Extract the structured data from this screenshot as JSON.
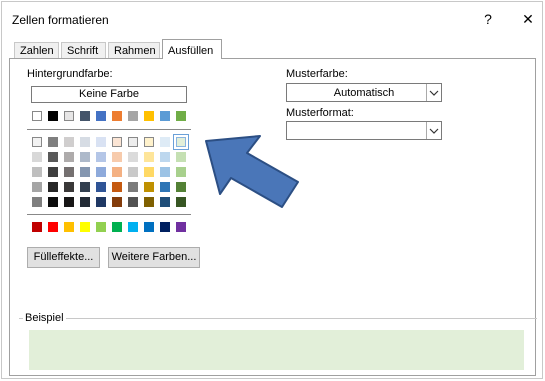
{
  "dialog": {
    "title": "Zellen formatieren",
    "help": "?",
    "close": "✕"
  },
  "tabs": [
    {
      "label": "Zahlen"
    },
    {
      "label": "Schrift"
    },
    {
      "label": "Rahmen"
    },
    {
      "label": "Ausfüllen",
      "active": true
    }
  ],
  "background": {
    "label": "Hintergrundfarbe:",
    "no_color_label": "Keine Farbe",
    "theme_top_row": [
      "#ffffff",
      "#000000",
      "#e7e6e6",
      "#44546a",
      "#4472c4",
      "#ed7d31",
      "#a5a5a5",
      "#ffc000",
      "#5b9bd5",
      "#70ad47"
    ],
    "theme_shades": [
      [
        "#f2f2f2",
        "#7f7f7f",
        "#d0cece",
        "#d6dce4",
        "#d9e2f3",
        "#fbe5d5",
        "#ededed",
        "#fff2cc",
        "#deebf6",
        "#e2efd9"
      ],
      [
        "#d8d8d8",
        "#595959",
        "#aeabab",
        "#adb9ca",
        "#b4c6e7",
        "#f7cbac",
        "#dbdbdb",
        "#fee599",
        "#bdd7ee",
        "#c5e0b3"
      ],
      [
        "#bfbfbf",
        "#3f3f3f",
        "#757070",
        "#8496b0",
        "#8eaadb",
        "#f4b183",
        "#c9c9c9",
        "#ffd965",
        "#9cc3e5",
        "#a8d08d"
      ],
      [
        "#a5a5a5",
        "#262626",
        "#3a3838",
        "#323f4f",
        "#2f5496",
        "#c55a11",
        "#7b7b7b",
        "#bf9000",
        "#2e75b5",
        "#538135"
      ],
      [
        "#7f7f7f",
        "#0c0c0c",
        "#171616",
        "#222a35",
        "#1f3864",
        "#833c0b",
        "#525252",
        "#7f6000",
        "#1f4e79",
        "#375623"
      ]
    ],
    "selected_color": "#e2efd9",
    "standard_colors": [
      "#c00000",
      "#ff0000",
      "#ffc000",
      "#ffff00",
      "#92d050",
      "#00b050",
      "#00b0f0",
      "#0070c0",
      "#002060",
      "#7030a0"
    ]
  },
  "buttons": {
    "fill_effects": "Fülleffekte...",
    "more_colors": "Weitere Farben..."
  },
  "pattern": {
    "color_label": "Musterfarbe:",
    "color_value": "Automatisch",
    "style_label": "Musterformat:",
    "style_value": ""
  },
  "sample": {
    "label": "Beispiel",
    "color": "#e2efd9"
  },
  "annotation": {
    "arrow_color": "#4a76b8"
  }
}
